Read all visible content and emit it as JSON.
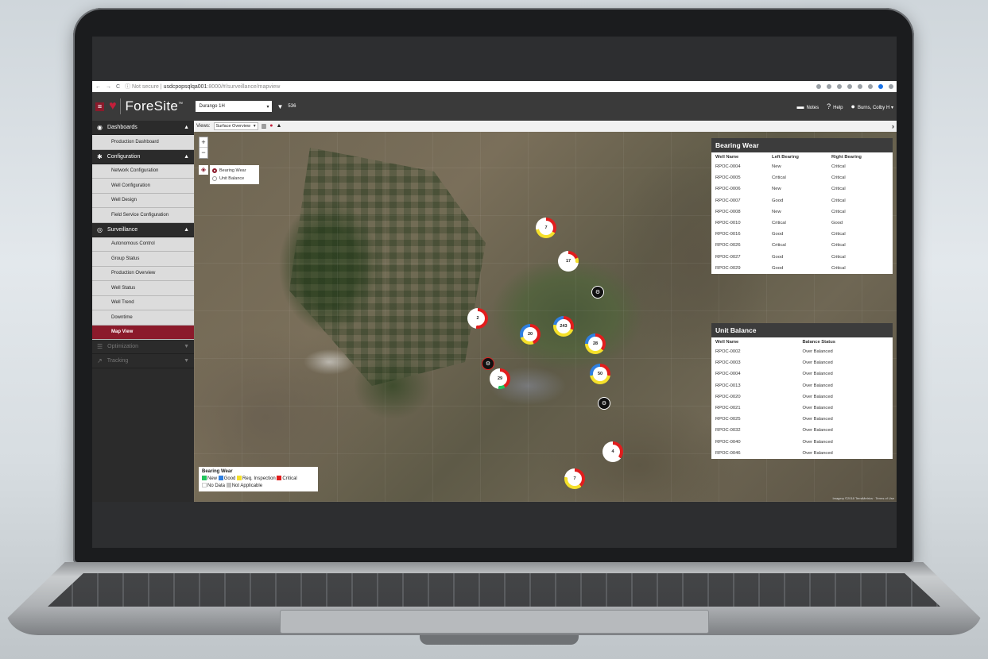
{
  "browser": {
    "not_secure": "ⓘ Not secure",
    "url_host": "usdcpopsqlqa001",
    "url_rest": ":8000/#/surveillance/mapview"
  },
  "header": {
    "brand": "ForeSite",
    "trademark": "™",
    "asset": "Durango 1H",
    "count": "536",
    "notes": "Notes",
    "help": "Help",
    "user": "Burns, Colby H"
  },
  "sidebar": {
    "dashboards": "Dashboards",
    "production_dashboard": "Production Dashboard",
    "configuration": "Configuration",
    "config_items": [
      "Network Configuration",
      "Well Configuration",
      "Well Design",
      "Field Service Configuration"
    ],
    "surveillance": "Surveillance",
    "surv_items": [
      "Autonomous Control",
      "Group Status",
      "Production Overview",
      "Well Status",
      "Well Trend",
      "Downtime",
      "Map View"
    ],
    "optimization": "Optimization",
    "tracking": "Tracking"
  },
  "views": {
    "label": "Views:",
    "selected": "Surface Overview"
  },
  "map": {
    "layers": [
      "Bearing Wear",
      "Unit Balance"
    ],
    "clusters": [
      "7",
      "17",
      "2",
      "243",
      "20",
      "28",
      "29",
      "50",
      "4",
      "7"
    ],
    "legend_title": "Bearing Wear",
    "legend_items": [
      {
        "label": "New",
        "color": "#22c55e"
      },
      {
        "label": "Good",
        "color": "#2f7fe0"
      },
      {
        "label": "Req. Inspection",
        "color": "#f5e02a"
      },
      {
        "label": "Critical",
        "color": "#e11d1d"
      },
      {
        "label": "No Data",
        "color": "#ffffff"
      },
      {
        "label": "Not Applicable",
        "color": "#bdbdbd"
      }
    ],
    "attribution": "Imagery ©2018 TerraMetrics · Terms of Use"
  },
  "bearing_wear": {
    "title": "Bearing Wear",
    "columns": [
      "Well Name",
      "Left Bearing",
      "Right Bearing"
    ],
    "rows": [
      [
        "RPOC-0004",
        "New",
        "Critical"
      ],
      [
        "RPOC-0005",
        "Critical",
        "Critical"
      ],
      [
        "RPOC-0006",
        "New",
        "Critical"
      ],
      [
        "RPOC-0007",
        "Good",
        "Critical"
      ],
      [
        "RPOC-0008",
        "New",
        "Critical"
      ],
      [
        "RPOC-0010",
        "Critical",
        "Good"
      ],
      [
        "RPOC-0016",
        "Good",
        "Critical"
      ],
      [
        "RPOC-0026",
        "Critical",
        "Critical"
      ],
      [
        "RPOC-0027",
        "Good",
        "Critical"
      ],
      [
        "RPOC-0029",
        "Good",
        "Critical"
      ]
    ]
  },
  "unit_balance": {
    "title": "Unit Balance",
    "columns": [
      "Well Name",
      "Balance Status"
    ],
    "rows": [
      [
        "RPOC-0002",
        "Over Balanced"
      ],
      [
        "RPOC-0003",
        "Over Balanced"
      ],
      [
        "RPOC-0004",
        "Over Balanced"
      ],
      [
        "RPOC-0013",
        "Over Balanced"
      ],
      [
        "RPOC-0020",
        "Over Balanced"
      ],
      [
        "RPOC-0021",
        "Over Balanced"
      ],
      [
        "RPOC-0025",
        "Over Balanced"
      ],
      [
        "RPOC-0032",
        "Over Balanced"
      ],
      [
        "RPOC-0040",
        "Over Balanced"
      ],
      [
        "RPOC-0046",
        "Over Balanced"
      ]
    ]
  }
}
